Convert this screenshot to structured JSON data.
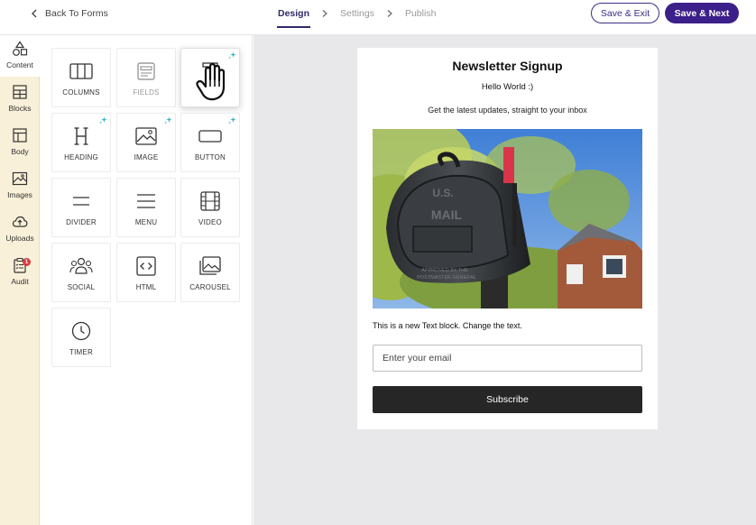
{
  "header": {
    "back_label": "Back To Forms",
    "steps": [
      {
        "label": "Design",
        "active": true
      },
      {
        "label": "Settings",
        "active": false
      },
      {
        "label": "Publish",
        "active": false
      }
    ],
    "save_exit_label": "Save & Exit",
    "save_next_label": "Save & Next"
  },
  "rail": {
    "items": [
      {
        "label": "Content",
        "icon": "shapes-icon",
        "active": true
      },
      {
        "label": "Blocks",
        "icon": "blocks-icon"
      },
      {
        "label": "Body",
        "icon": "body-layout-icon"
      },
      {
        "label": "Images",
        "icon": "image-icon"
      },
      {
        "label": "Uploads",
        "icon": "cloud-upload-icon"
      },
      {
        "label": "Audit",
        "icon": "clipboard-icon",
        "badge": "1"
      }
    ]
  },
  "tiles": [
    {
      "label": "COLUMNS",
      "icon": "columns-icon"
    },
    {
      "label": "FIELDS",
      "icon": "fields-icon",
      "muted": true
    },
    {
      "label": "",
      "icon": "text-icon",
      "sparkle": true,
      "dragging": true
    },
    {
      "label": "HEADING",
      "icon": "heading-icon",
      "sparkle": true
    },
    {
      "label": "IMAGE",
      "icon": "image-icon",
      "sparkle": true
    },
    {
      "label": "BUTTON",
      "icon": "button-icon",
      "sparkle": true
    },
    {
      "label": "DIVIDER",
      "icon": "divider-icon"
    },
    {
      "label": "MENU",
      "icon": "menu-icon"
    },
    {
      "label": "VIDEO",
      "icon": "video-icon"
    },
    {
      "label": "SOCIAL",
      "icon": "social-icon"
    },
    {
      "label": "HTML",
      "icon": "code-icon"
    },
    {
      "label": "CAROUSEL",
      "icon": "carousel-icon"
    },
    {
      "label": "TIMER",
      "icon": "timer-icon"
    }
  ],
  "form": {
    "title": "Newsletter Signup",
    "hello": "Hello World :)",
    "subtitle": "Get the latest updates, straight to your inbox",
    "image_text_line1": "U.S.",
    "image_text_line2": "MAIL",
    "image_text_line3": "APPROVED BY THE",
    "image_text_line4": "POSTMASTER GENERAL",
    "text_block": "This is a new Text block. Change the text.",
    "email_placeholder": "Enter your email",
    "subscribe_label": "Subscribe"
  },
  "colors": {
    "accent": "#3b1f8a",
    "active_step": "#2f2a6b",
    "rail_bg": "#f9f0d9",
    "canvas_bg": "#e8e8ea",
    "sparkle": "#2bb6c9",
    "badge": "#d93a3a"
  }
}
